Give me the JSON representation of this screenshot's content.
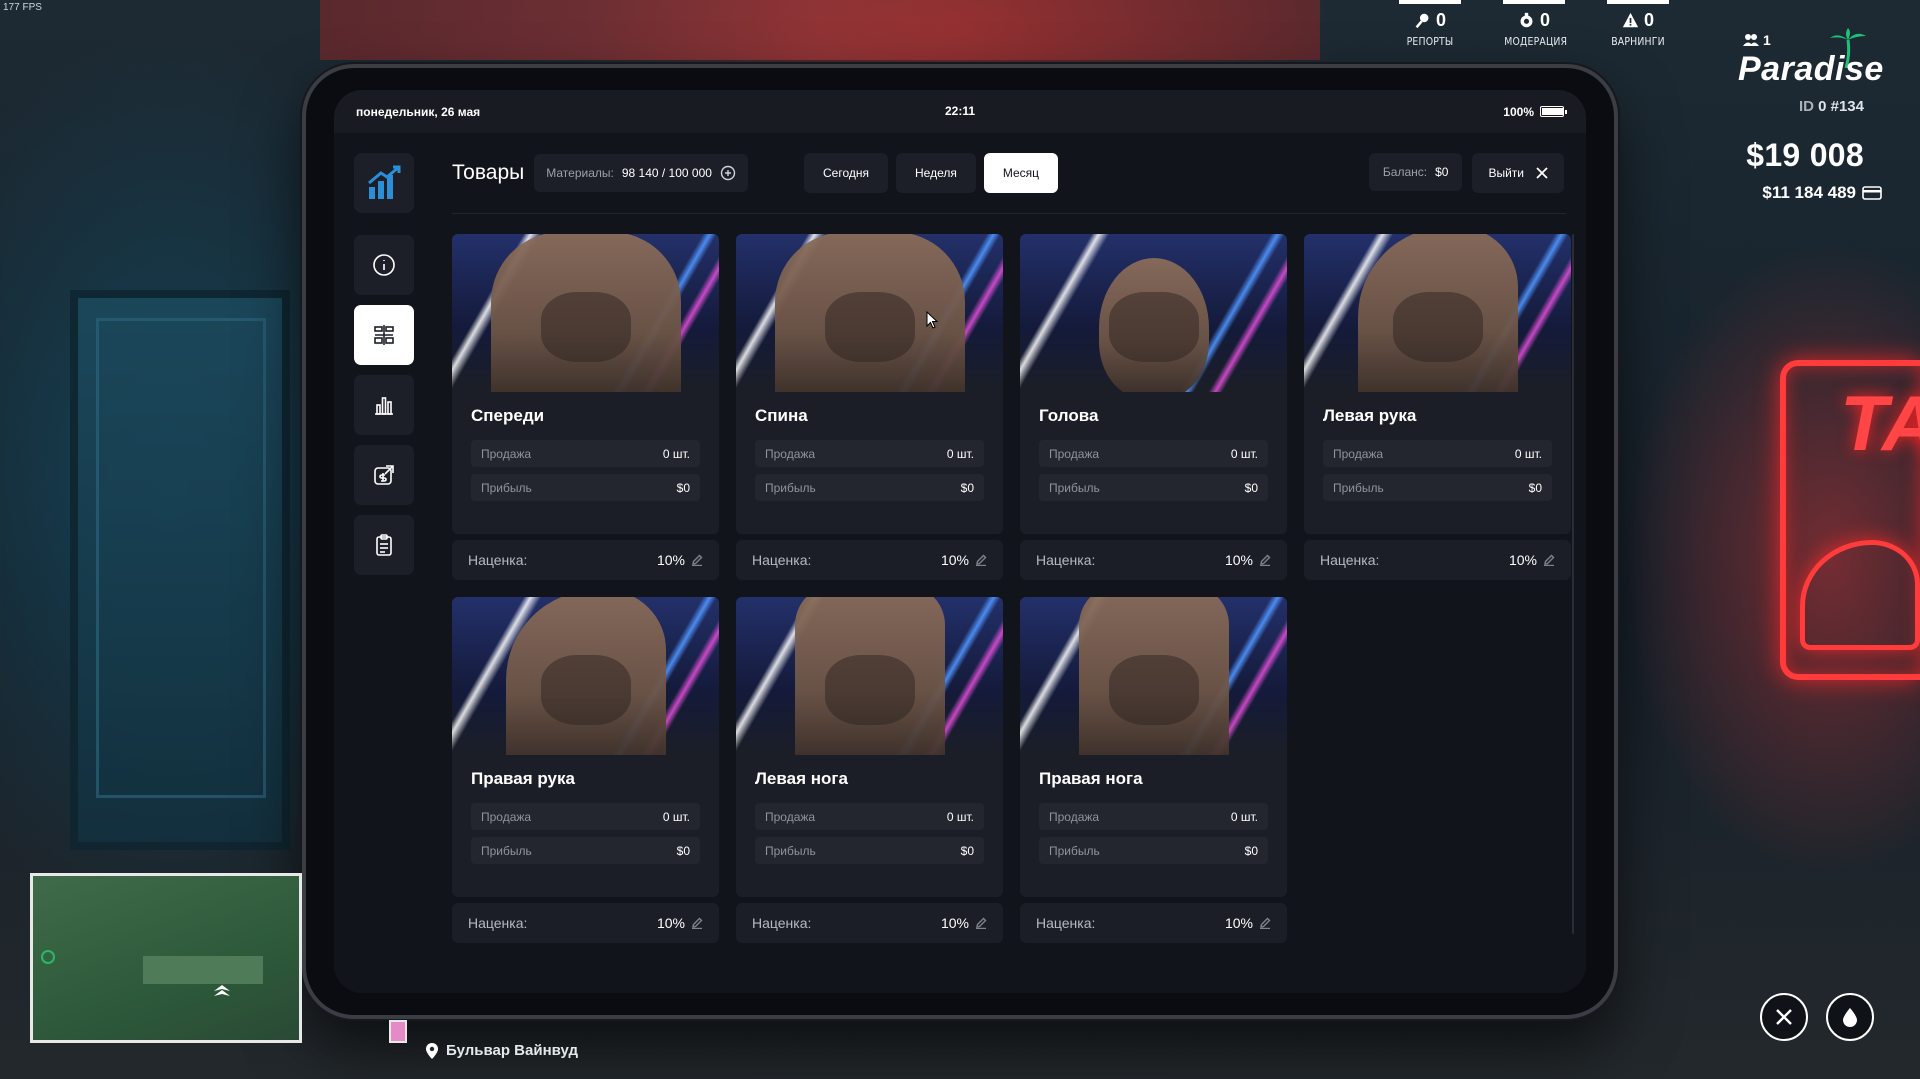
{
  "fps": "177 FPS",
  "hud": {
    "stats": [
      {
        "value": "0",
        "label": "РЕПОРТЫ",
        "icon": "reports-icon"
      },
      {
        "value": "0",
        "label": "МОДЕРАЦИЯ",
        "icon": "moderation-icon"
      },
      {
        "value": "0",
        "label": "ВАРНИНГИ",
        "icon": "warning-icon"
      }
    ],
    "online_count": "1",
    "logo": "Paradise",
    "player_id_label": "ID",
    "player_id": "0 #134",
    "cash": "$19 008",
    "bank": "$11 184 489"
  },
  "tablet": {
    "date": "понедельник, 26 мая",
    "time": "22:11",
    "battery": "100%",
    "battery_level": 1.0
  },
  "sidebar": {
    "items": [
      {
        "icon": "info-icon",
        "active": false
      },
      {
        "icon": "goods-icon",
        "active": true
      },
      {
        "icon": "stats-icon",
        "active": false
      },
      {
        "icon": "finance-icon",
        "active": false
      },
      {
        "icon": "clipboard-icon",
        "active": false
      }
    ]
  },
  "header": {
    "title": "Товары",
    "materials_label": "Материалы:",
    "materials_value": "98 140 / 100 000",
    "periods": [
      "Сегодня",
      "Неделя",
      "Месяц"
    ],
    "active_period": "Месяц",
    "balance_label": "Баланс:",
    "balance_value": "$0",
    "exit_label": "Выйти"
  },
  "labels": {
    "sale": "Продажа",
    "profit": "Прибыль",
    "markup": "Наценка:"
  },
  "products": [
    {
      "name": "Спереди",
      "sale": "0 шт.",
      "profit": "$0",
      "markup": "10%",
      "kind": "torso"
    },
    {
      "name": "Спина",
      "sale": "0 шт.",
      "profit": "$0",
      "markup": "10%",
      "kind": "torso"
    },
    {
      "name": "Голова",
      "sale": "0 шт.",
      "profit": "$0",
      "markup": "10%",
      "kind": "head"
    },
    {
      "name": "Левая рука",
      "sale": "0 шт.",
      "profit": "$0",
      "markup": "10%",
      "kind": "arm"
    },
    {
      "name": "Правая рука",
      "sale": "0 шт.",
      "profit": "$0",
      "markup": "10%",
      "kind": "arm"
    },
    {
      "name": "Левая нога",
      "sale": "0 шт.",
      "profit": "$0",
      "markup": "10%",
      "kind": "leg"
    },
    {
      "name": "Правая нога",
      "sale": "0 шт.",
      "profit": "$0",
      "markup": "10%",
      "kind": "leg"
    }
  ],
  "location": "Бульвар Вайнвуд",
  "colors": {
    "panel": "#1b1e26",
    "accent_white": "#ffffff",
    "neon_red": "#ff3b3b"
  }
}
